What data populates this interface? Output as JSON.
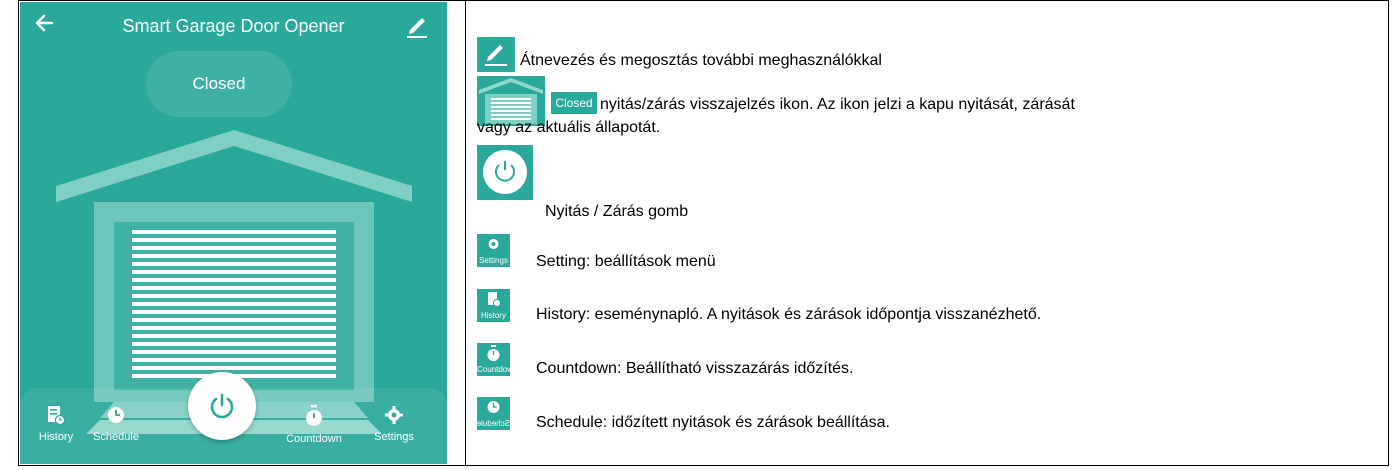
{
  "phone": {
    "title": "Smart Garage Door Opener",
    "status": "Closed",
    "nav": {
      "history": "History",
      "schedule": "Schedule",
      "countdown": "Countdown",
      "settings": "Settings"
    }
  },
  "legend": {
    "rename": "Átnevezés és megosztás további meghasználókkal",
    "chip_closed": "Closed",
    "feedback_line1": "nyitás/zárás visszajelzés ikon. Az ikon jelzi a kapu nyitását, zárását",
    "feedback_line2": "vagy az aktuális állapotát.",
    "power": "Nyitás / Zárás gomb",
    "settings_icon_label": "Settings",
    "settings": "Setting: beállítások menü",
    "history_icon_label": "History",
    "history": "History: eseménynapló. A nyitások és zárások időpontja visszanézhető.",
    "countdown_icon_label": "Countdown",
    "countdown": "Countdown: Beállítható visszazárás időzítés.",
    "schedule_icon_label": "Schedule",
    "schedule": "Schedule: időzített nyitások és zárások beállítása."
  },
  "colors": {
    "teal": "#2aa89a",
    "white": "#ffffff"
  }
}
